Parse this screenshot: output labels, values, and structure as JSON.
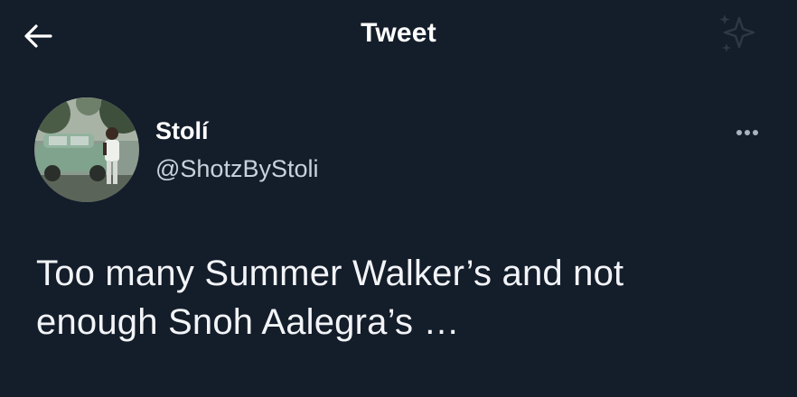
{
  "header": {
    "title": "Tweet",
    "back_icon": "arrow-left-icon",
    "right_icon": "sparkle-icon"
  },
  "author": {
    "display_name": "Stolí",
    "handle": "@ShotzByStoli",
    "avatar_icon": "profile-photo"
  },
  "tweet": {
    "text_line1": "Too many Summer Walker’s and not",
    "text_line2": "enough Snoh Aalegra’s …"
  },
  "menu": {
    "more_icon": "more-options-icon"
  },
  "colors": {
    "background": "#141d2a",
    "text": "#ffffff",
    "secondary_text": "#c9d1db"
  }
}
